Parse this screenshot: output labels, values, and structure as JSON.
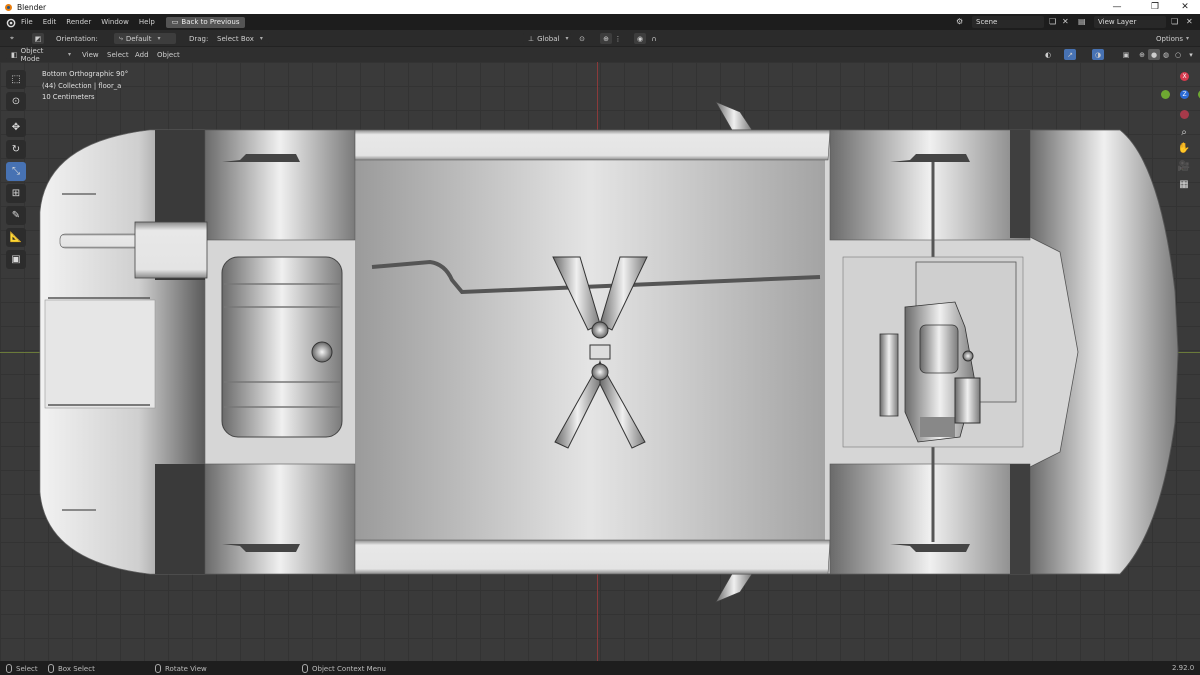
{
  "window": {
    "title": "Blender",
    "controls": {
      "minimize": "—",
      "maximize": "❐",
      "close": "✕"
    }
  },
  "topbar": {
    "menus": [
      "File",
      "Edit",
      "Render",
      "Window",
      "Help"
    ],
    "back_button": "Back to Previous",
    "scene": "Scene",
    "view_layer": "View Layer"
  },
  "tool_header": {
    "orientation_label": "Orientation:",
    "orientation_value": "Default",
    "drag_label": "Drag:",
    "drag_value": "Select Box",
    "transform_orientation": "Global",
    "options": "Options"
  },
  "view_header": {
    "mode": "Object Mode",
    "menus": [
      "View",
      "Select",
      "Add",
      "Object"
    ]
  },
  "viewport": {
    "info_view": "Bottom Orthographic 90°",
    "info_collection": "(44) Collection | floor_a",
    "info_scale": "10 Centimeters"
  },
  "gizmo": {
    "x": "X",
    "z": "Z",
    "y": "Y"
  },
  "statusbar": {
    "select": "Select",
    "box_select": "Box Select",
    "rotate_view": "Rotate View",
    "context_menu": "Object Context Menu",
    "version": "2.92.0"
  }
}
